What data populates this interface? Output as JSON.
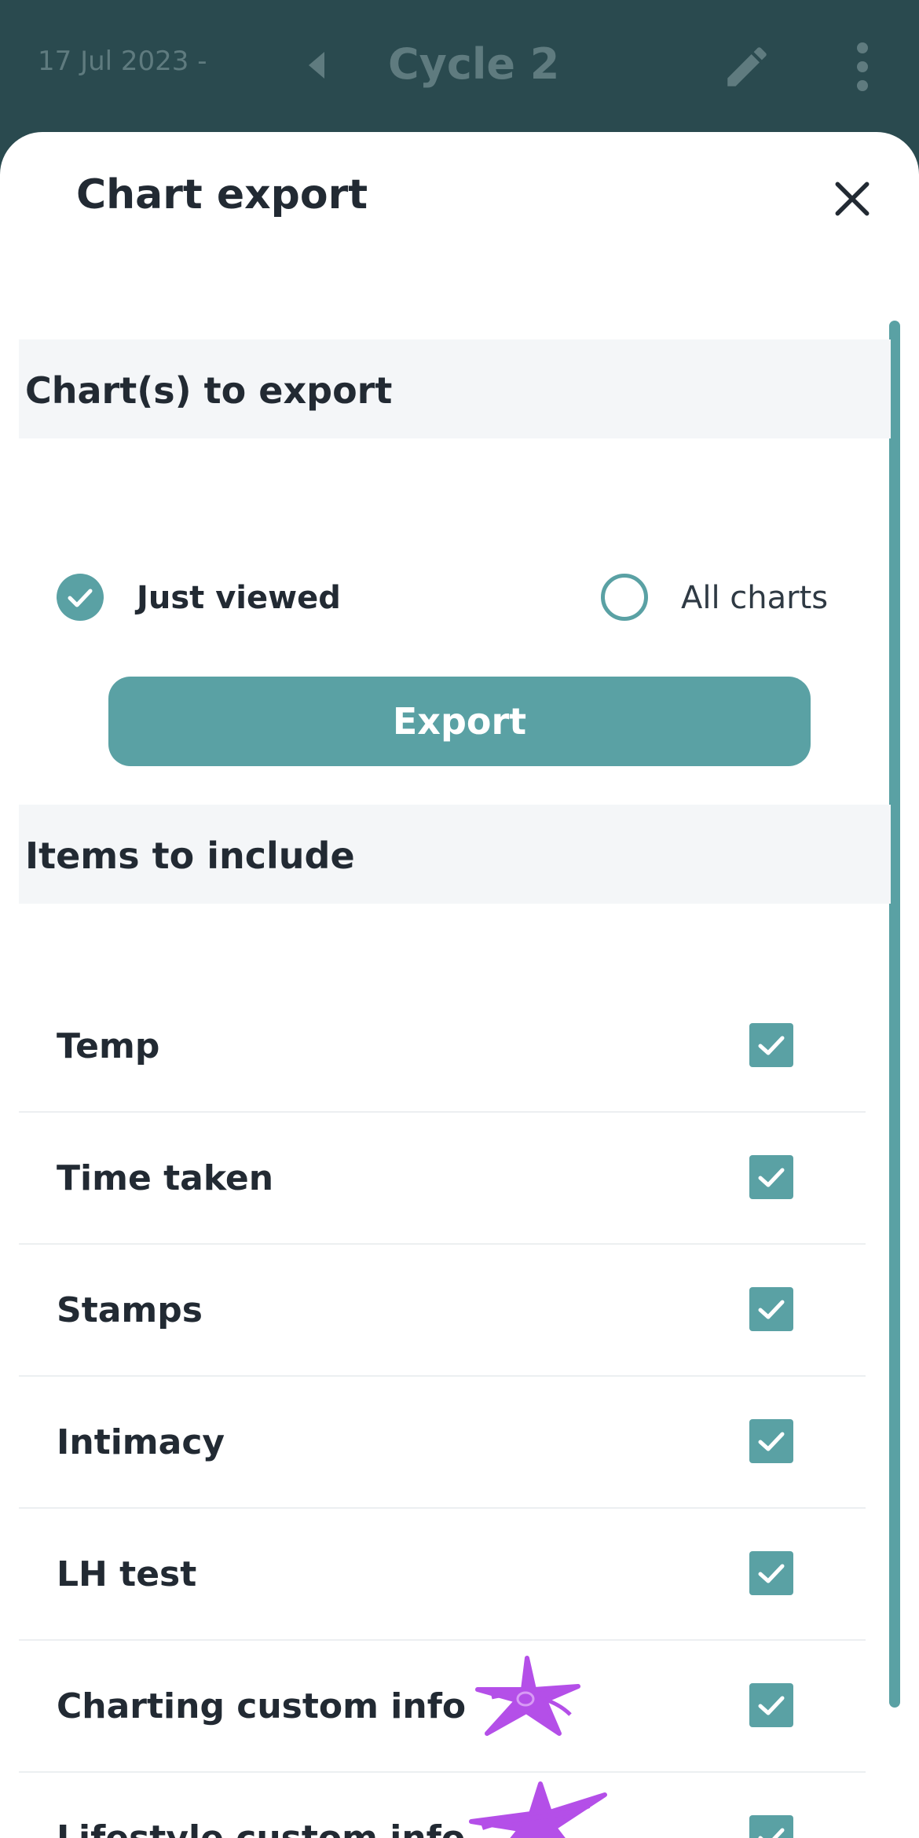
{
  "appbar": {
    "date": "17 Jul 2023 -",
    "title": "Cycle 2"
  },
  "sheet": {
    "title": "Chart export",
    "section_charts": "Chart(s) to export",
    "radio_just_viewed": "Just viewed",
    "radio_all_charts": "All charts",
    "selected": "Just viewed",
    "export_label": "Export",
    "section_items": "Items to include",
    "items": [
      {
        "label": "Temp",
        "checked": true
      },
      {
        "label": "Time taken",
        "checked": true
      },
      {
        "label": "Stamps",
        "checked": true
      },
      {
        "label": "Intimacy",
        "checked": true
      },
      {
        "label": "LH test",
        "checked": true
      },
      {
        "label": "Charting custom info",
        "checked": true
      },
      {
        "label": "Lifestyle custom info",
        "checked": true
      }
    ]
  },
  "colors": {
    "accent": "#5aa1a4",
    "appbar": "#2a4a4f",
    "scribble": "#b44fe8"
  }
}
